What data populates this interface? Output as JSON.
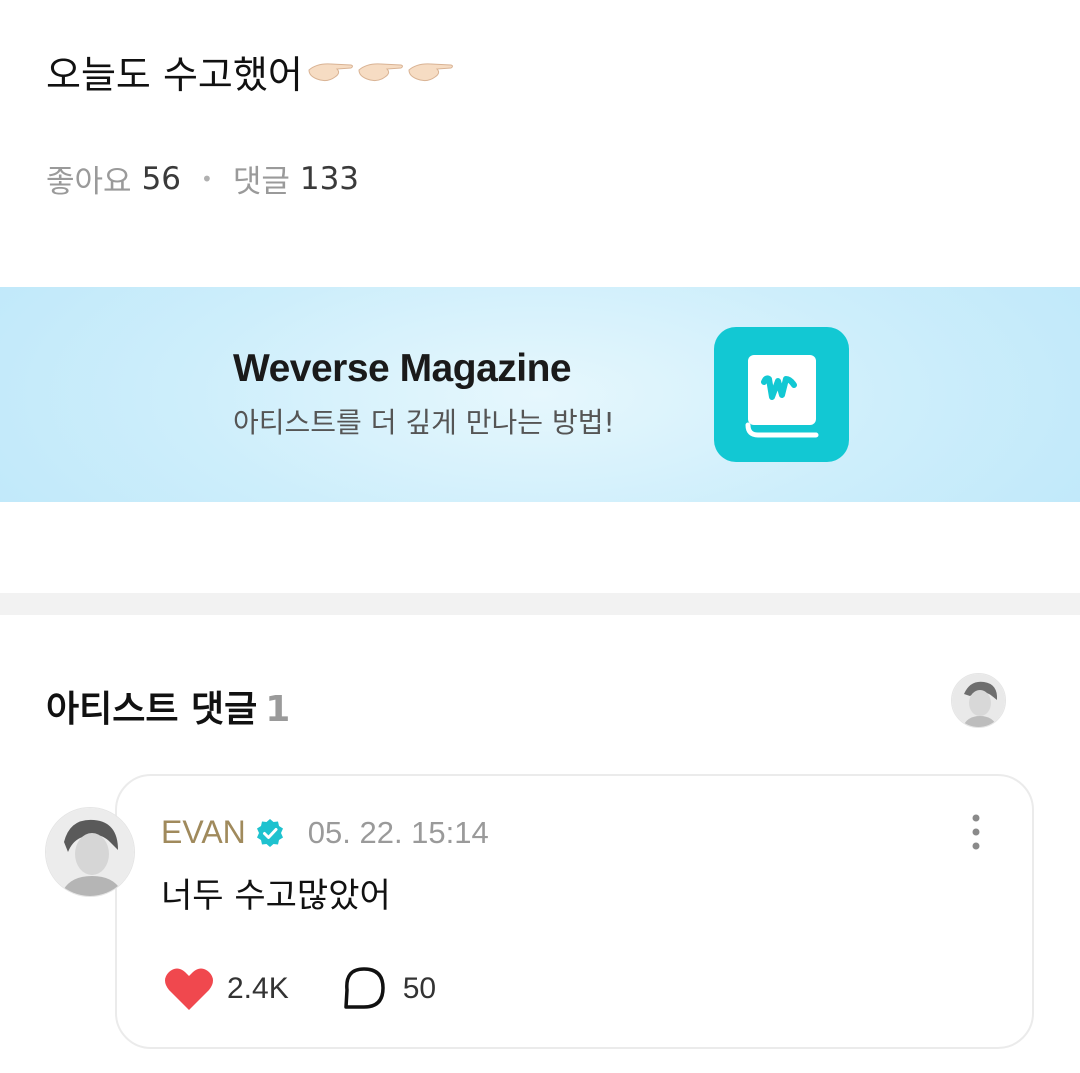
{
  "post": {
    "text": "오늘도 수고했어",
    "hand_emoji": "pointing-hand-icon",
    "likes_label": "좋아요",
    "likes_count": "56",
    "comments_label": "댓글",
    "comments_count": "133"
  },
  "banner": {
    "title": "Weverse Magazine",
    "subtitle": "아티스트를 더 깊게 만나는 방법!",
    "app_icon": "weverse-magazine-app-icon",
    "app_color": "#12c8d3"
  },
  "artist_comments": {
    "title": "아티스트 댓글",
    "count": "1"
  },
  "comment": {
    "author": "EVAN",
    "date": "05. 22. 15:14",
    "text": "너두 수고많았어",
    "likes": "2.4K",
    "replies": "50",
    "author_color": "#a08a5c",
    "heart_color": "#f0484e",
    "verified_color": "#1ec2cf"
  }
}
